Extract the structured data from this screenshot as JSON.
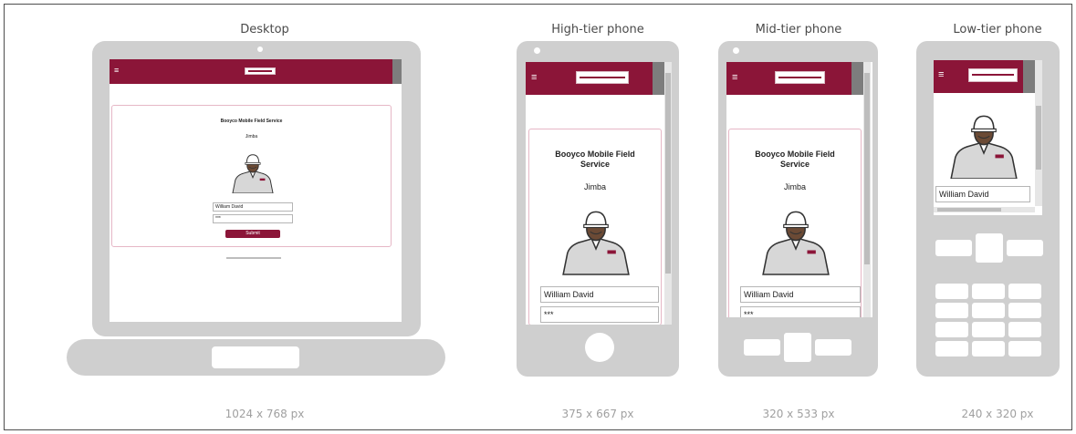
{
  "devices": {
    "desktop": {
      "title": "Desktop",
      "resolution": "1024 x 768 px"
    },
    "high": {
      "title": "High-tier phone",
      "resolution": "375 x 667 px"
    },
    "mid": {
      "title": "Mid-tier phone",
      "resolution": "320 x 533 px"
    },
    "low": {
      "title": "Low-tier phone",
      "resolution": "240 x 320 px"
    }
  },
  "app": {
    "menu_icon": "≡",
    "title_line1": "Booyco Mobile Field",
    "title_line2": "Service",
    "title_full": "Booyco Mobile Field Service",
    "subtitle": "Jimba",
    "username": "William David",
    "password": "***",
    "submit": "Submit"
  },
  "colors": {
    "brand": "#8b1538",
    "device": "#cfcfcf",
    "card_border": "#e6b7c6"
  },
  "icons": [
    "hamburger-menu-icon",
    "worker-avatar-icon",
    "home-button-icon"
  ]
}
